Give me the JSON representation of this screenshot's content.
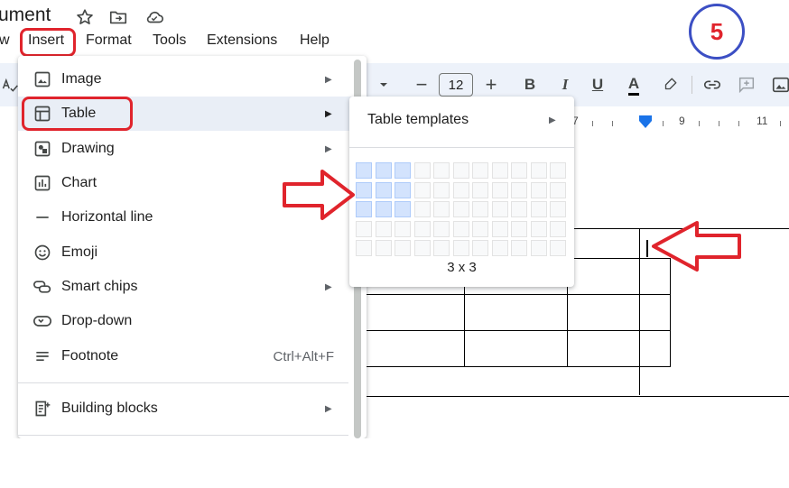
{
  "header": {
    "doc_title": "ument",
    "star_icon": "star-icon",
    "move_icon": "folder-move-icon",
    "cloud_icon": "cloud-status-icon"
  },
  "menubar": {
    "items": [
      "w",
      "Insert",
      "Format",
      "Tools",
      "Extensions",
      "Help"
    ]
  },
  "toolbar": {
    "font_size": "12",
    "decrease": "−",
    "increase": "+",
    "bold": "B",
    "italic": "I",
    "underline": "U",
    "text_color": "A"
  },
  "ruler": {
    "labels": [
      "7",
      "9",
      "11"
    ]
  },
  "insert_menu": {
    "items": [
      {
        "label": "Image",
        "icon": "image-icon",
        "has_submenu": true
      },
      {
        "label": "Table",
        "icon": "table-icon",
        "has_submenu": true
      },
      {
        "label": "Drawing",
        "icon": "drawing-icon",
        "has_submenu": true
      },
      {
        "label": "Chart",
        "icon": "chart-icon",
        "has_submenu": true
      },
      {
        "label": "Horizontal line",
        "icon": "horizontal-line-icon",
        "has_submenu": false
      },
      {
        "label": "Emoji",
        "icon": "emoji-icon",
        "has_submenu": false
      },
      {
        "label": "Smart chips",
        "icon": "smart-chips-icon",
        "has_submenu": true
      },
      {
        "label": "Drop-down",
        "icon": "dropdown-icon",
        "has_submenu": false
      },
      {
        "label": "Footnote",
        "icon": "footnote-icon",
        "has_submenu": false,
        "shortcut": "Ctrl+Alt+F"
      },
      {
        "label": "Building blocks",
        "icon": "building-blocks-icon",
        "has_submenu": true
      }
    ]
  },
  "table_submenu": {
    "templates_label": "Table templates",
    "grid_selection": "3 x 3",
    "grid_cols": 11,
    "grid_rows": 5,
    "selected_cols": 3,
    "selected_rows": 3
  },
  "annotation": {
    "step_number": "5"
  },
  "colors": {
    "annotation_red": "#e0242c",
    "annotation_blue": "#3c4fc4",
    "menu_highlight": "#e9eef6",
    "grid_selected": "#d3e3fd",
    "toolbar_bg": "#edf2fa"
  }
}
